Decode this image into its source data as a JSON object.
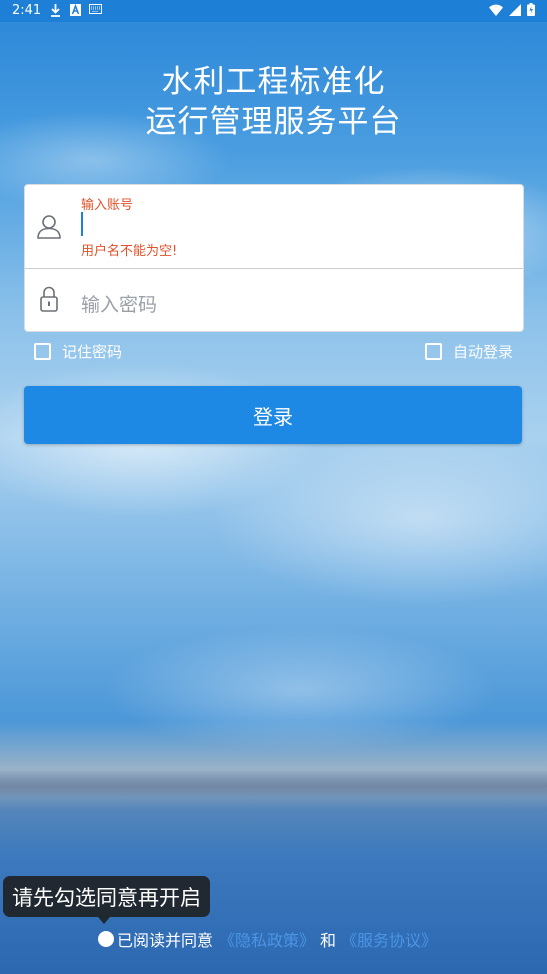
{
  "status_bar": {
    "time": "2:41",
    "left_icons": [
      "download-icon",
      "a-icon",
      "keyboard-icon"
    ],
    "right_icons": [
      "wifi-icon",
      "signal-icon",
      "battery-icon"
    ]
  },
  "title": {
    "line1": "水利工程标准化",
    "line2": "运行管理服务平台"
  },
  "form": {
    "account_label": "输入账号",
    "account_value": "",
    "account_error": "用户名不能为空!",
    "password_placeholder": "输入密码"
  },
  "options": {
    "remember_password": "记住密码",
    "remember_checked": false,
    "auto_login": "自动登录",
    "auto_login_checked": false
  },
  "login_button": "登录",
  "toast": "请先勾选同意再开启",
  "agreement": {
    "prefix": "已阅读并同意",
    "privacy_link": "《隐私政策》",
    "conjunction": "和",
    "service_link": "《服务协议》",
    "checked": false
  },
  "colors": {
    "accent": "#1e88e5",
    "error": "#e0522a",
    "link": "#4a95e6"
  }
}
